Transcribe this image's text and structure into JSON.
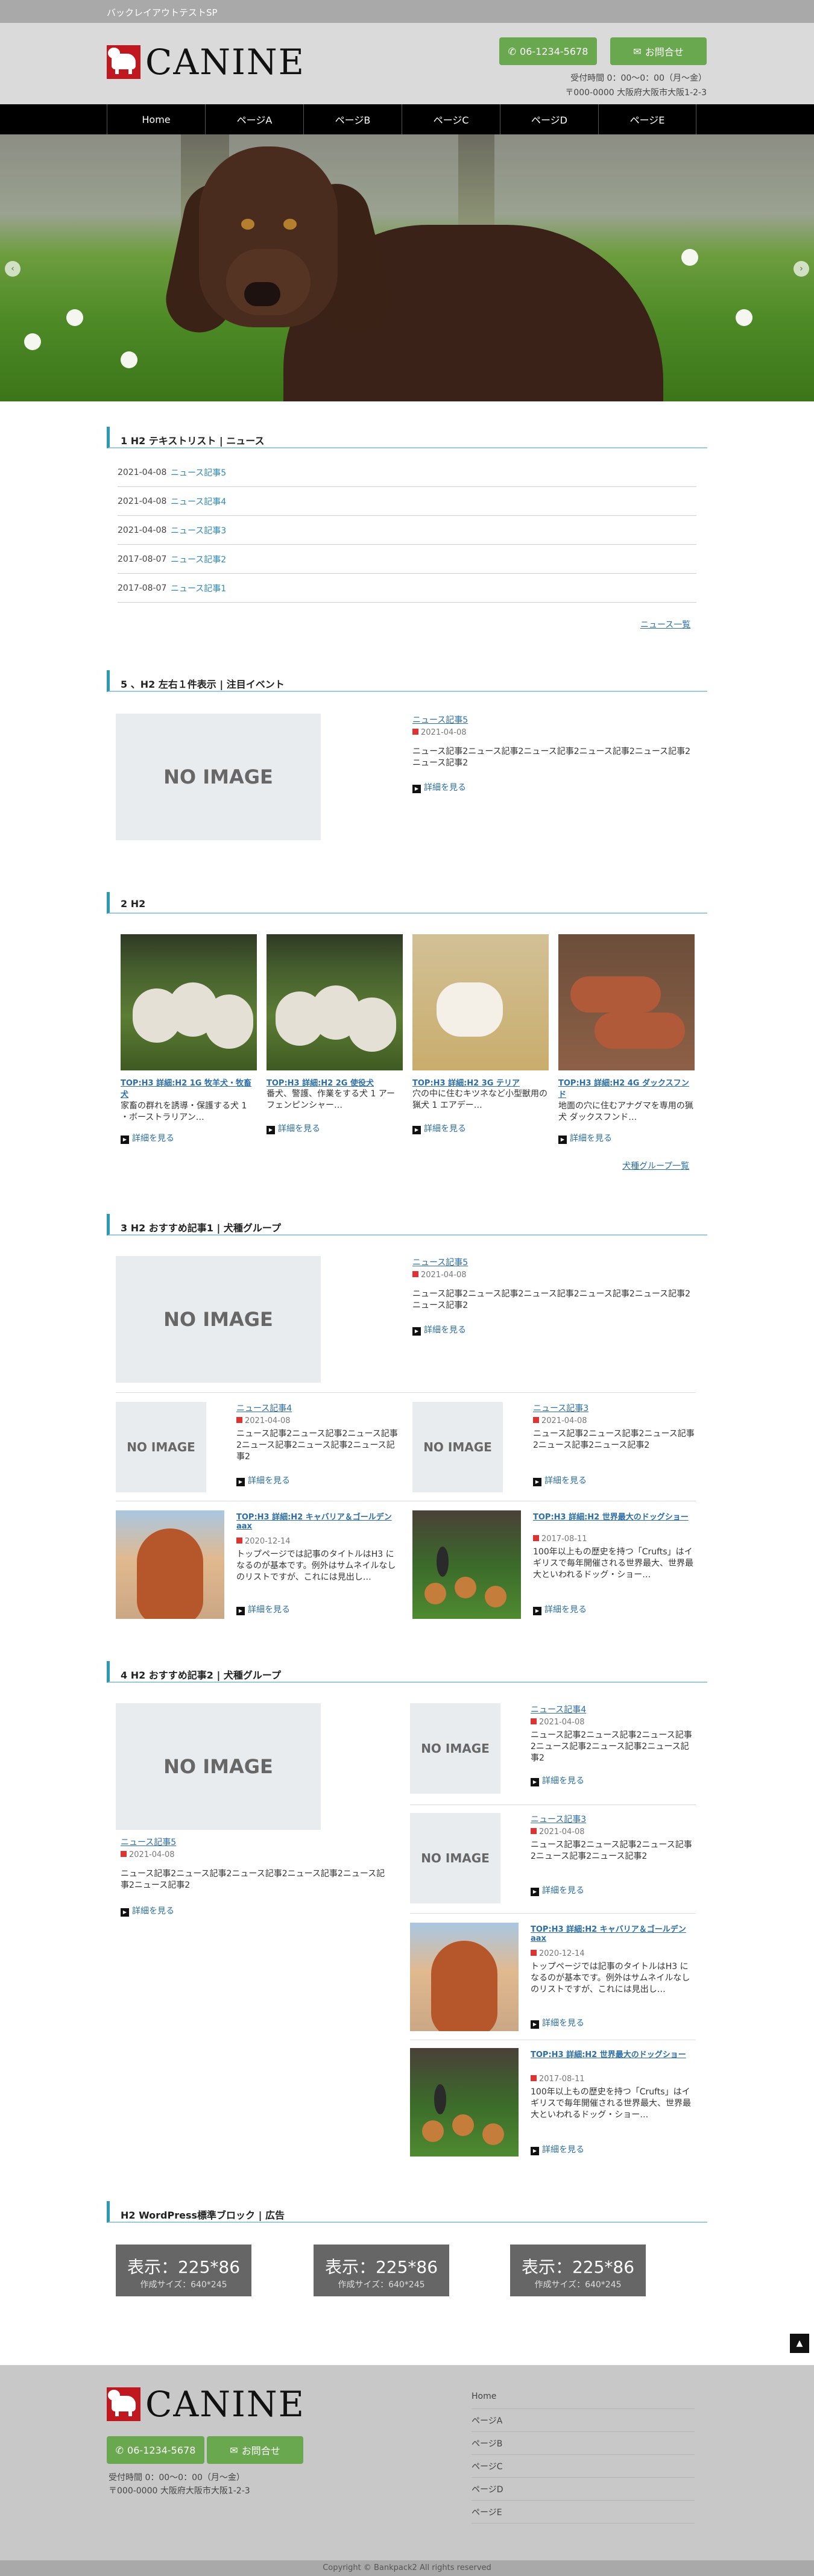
{
  "topbar": {
    "text": "バックレイアウトテストSP"
  },
  "header": {
    "logo": "CANINE",
    "tel": "06-1234-5678",
    "mail": "お問合せ",
    "hours": "受付時間 0：00～0：00（月～金）",
    "address": "〒000-0000 大阪府大阪市大阪1-2-3"
  },
  "nav": [
    "Home",
    "ページA",
    "ページB",
    "ページC",
    "ページD",
    "ページE"
  ],
  "slider": {
    "prev": "‹",
    "next": "›"
  },
  "sec1": {
    "title": "1 H2 テキストリスト | ニュース",
    "items": [
      {
        "date": "2021-04-08",
        "title": "ニュース記事5"
      },
      {
        "date": "2021-04-08",
        "title": "ニュース記事4"
      },
      {
        "date": "2021-04-08",
        "title": "ニュース記事3"
      },
      {
        "date": "2017-08-07",
        "title": "ニュース記事2"
      },
      {
        "date": "2017-08-07",
        "title": "ニュース記事1"
      }
    ],
    "more": "ニュース一覧"
  },
  "sec2": {
    "title": "5 、H2 左右１件表示 | 注目イベント",
    "noimage": "NO IMAGE",
    "post": {
      "title": "ニュース記事5",
      "date": "2021-04-08",
      "excerpt": "ニュース記事2ニュース記事2ニュース記事2ニュース記事2ニュース記事2ニュース記事2",
      "more": "詳細を見る"
    }
  },
  "sec3": {
    "title": "2 H2",
    "cards": [
      {
        "title": "TOP:H3 詳細:H2 1G 牧羊犬・牧畜犬",
        "excerpt": "家畜の群れを誘導・保護する犬 1 ・ボーストラリアン…",
        "more": "詳細を見る"
      },
      {
        "title": "TOP:H3 詳細:H2 2G 使役犬",
        "excerpt": "番犬、警護、作業をする犬 1 アーフェンピンシャー…",
        "more": "詳細を見る"
      },
      {
        "title": "TOP:H3 詳細:H2 3G テリア",
        "excerpt": "穴の中に住むキツネなど小型獣用の猟犬 1 エアデー…",
        "more": "詳細を見る"
      },
      {
        "title": "TOP:H3 詳細:H2 4G ダックスフンド",
        "excerpt": "地面の穴に住むアナグマを専用の猟犬 ダックスフンド…",
        "more": "詳細を見る"
      }
    ],
    "more": "犬種グループ一覧"
  },
  "sec4": {
    "title": "3 H2 おすすめ記事1 | 犬種グループ",
    "main": {
      "title": "ニュース記事5",
      "date": "2021-04-08",
      "excerpt": "ニュース記事2ニュース記事2ニュース記事2ニュース記事2ニュース記事2ニュース記事2",
      "more": "詳細を見る"
    },
    "items": [
      {
        "title": "ニュース記事4",
        "date": "2021-04-08",
        "excerpt": "ニュース記事2ニュース記事2ニュース記事2ニュース記事2ニュース記事2ニュース記事2",
        "more": "詳細を見る"
      },
      {
        "title": "ニュース記事3",
        "date": "2021-04-08",
        "excerpt": "ニュース記事2ニュース記事2ニュース記事2ニュース記事2ニュース記事2",
        "more": "詳細を見る"
      },
      {
        "title": "TOP:H3 詳細:H2 キャバリア＆ゴールデン",
        "title2": "aax",
        "date": "2020-12-14",
        "excerpt": "トップページでは記事のタイトルはH3 になるのが基本です。例外はサムネイルなしのリストですが、これには見出し…",
        "more": "詳細を見る"
      },
      {
        "title": "TOP:H3 詳細:H2 世界最大のドッグショー",
        "date": "2017-08-11",
        "excerpt": "100年以上もの歴史を持つ「Crufts」はイギリスで毎年開催される世界最大、世界最大といわれるドッグ・ショー…",
        "more": "詳細を見る"
      }
    ]
  },
  "sec5": {
    "title": "4 H2 おすすめ記事2 | 犬種グループ",
    "main": {
      "title": "ニュース記事5",
      "date": "2021-04-08",
      "excerpt": "ニュース記事2ニュース記事2ニュース記事2ニュース記事2ニュース記事2ニュース記事2",
      "more": "詳細を見る"
    },
    "items": [
      {
        "title": "ニュース記事4",
        "date": "2021-04-08",
        "excerpt": "ニュース記事2ニュース記事2ニュース記事2ニュース記事2ニュース記事2ニュース記事2",
        "more": "詳細を見る"
      },
      {
        "title": "ニュース記事3",
        "date": "2021-04-08",
        "excerpt": "ニュース記事2ニュース記事2ニュース記事2ニュース記事2ニュース記事2",
        "more": "詳細を見る"
      },
      {
        "title": "TOP:H3 詳細:H2 キャバリア＆ゴールデンaax",
        "date": "2020-12-14",
        "excerpt": "トップページでは記事のタイトルはH3 になるのが基本です。例外はサムネイルなしのリストですが、これには見出し…",
        "more": "詳細を見る"
      },
      {
        "title": "TOP:H3 詳細:H2 世界最大のドッグショー",
        "date": "2017-08-11",
        "excerpt": "100年以上もの歴史を持つ「Crufts」はイギリスで毎年開催される世界最大、世界最大といわれるドッグ・ショー…",
        "more": "詳細を見る"
      }
    ]
  },
  "sec6": {
    "title": "H2 WordPress標準ブロック | 広告",
    "ads": [
      {
        "l1": "表示：225*86",
        "l2": "作成サイズ：640*245"
      },
      {
        "l1": "表示：225*86",
        "l2": "作成サイズ：640*245"
      },
      {
        "l1": "表示：225*86",
        "l2": "作成サイズ：640*245"
      }
    ]
  },
  "totop": "▲",
  "footer": {
    "logo": "CANINE",
    "tel": "06-1234-5678",
    "mail": "お問合せ",
    "hours": "受付時間 0：00～0：00（月～金）",
    "address": "〒000-0000 大阪府大阪市大阪1-2-3",
    "nav": [
      "Home",
      "ページA",
      "ページB",
      "ページC",
      "ページD",
      "ページE"
    ],
    "copy": "Copyright © Bankpack2 All rights reserved"
  }
}
